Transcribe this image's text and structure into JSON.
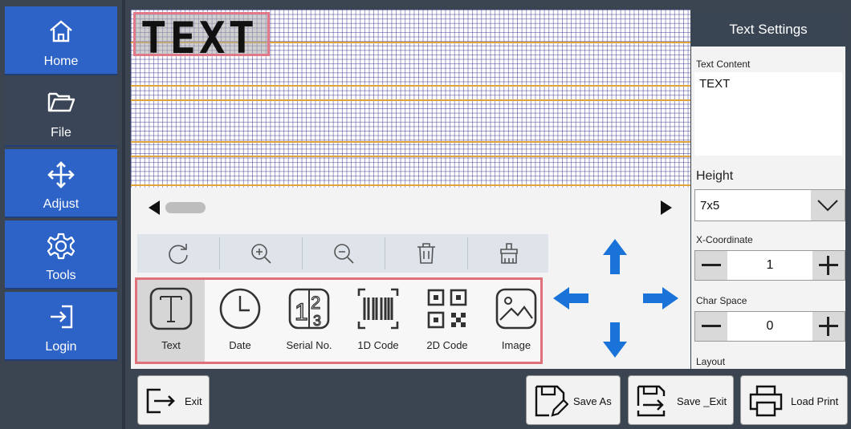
{
  "sidebar": {
    "items": [
      {
        "label": "Home",
        "icon": "home-icon"
      },
      {
        "label": "File",
        "icon": "folder-icon"
      },
      {
        "label": "Adjust",
        "icon": "move-icon"
      },
      {
        "label": "Tools",
        "icon": "gear-icon"
      },
      {
        "label": "Login",
        "icon": "login-icon"
      }
    ]
  },
  "canvas": {
    "object_text": "TEXT"
  },
  "toolbar": {
    "buttons": [
      "rotate-icon",
      "zoom-in-icon",
      "zoom-out-icon",
      "trash-icon",
      "clean-icon"
    ]
  },
  "insert": {
    "items": [
      {
        "label": "Text",
        "icon": "text-icon"
      },
      {
        "label": "Date",
        "icon": "clock-icon"
      },
      {
        "label": "Serial No.",
        "icon": "serial-number-icon"
      },
      {
        "label": "1D Code",
        "icon": "barcode-icon"
      },
      {
        "label": "2D Code",
        "icon": "qr-code-icon"
      },
      {
        "label": "Image",
        "icon": "image-icon"
      }
    ]
  },
  "settings": {
    "title": "Text Settings",
    "text_content_label": "Text Content",
    "text_content_value": "TEXT",
    "height_label": "Height",
    "height_value": "7x5",
    "x_coordinate_label": "X-Coordinate",
    "x_coordinate_value": "1",
    "char_space_label": "Char Space",
    "char_space_value": "0",
    "layout_label": "Layout"
  },
  "bottom": {
    "exit_label": "Exit",
    "save_as_label": "Save As",
    "save_exit_label": "Save _Exit",
    "load_print_label": "Load Print"
  },
  "colors": {
    "nav_blue": "#2d63c6",
    "dark_bg": "#3b4451",
    "arrow_blue": "#1a73d9",
    "selection_border": "#e0707a",
    "guide_orange": "#e0a43a"
  }
}
